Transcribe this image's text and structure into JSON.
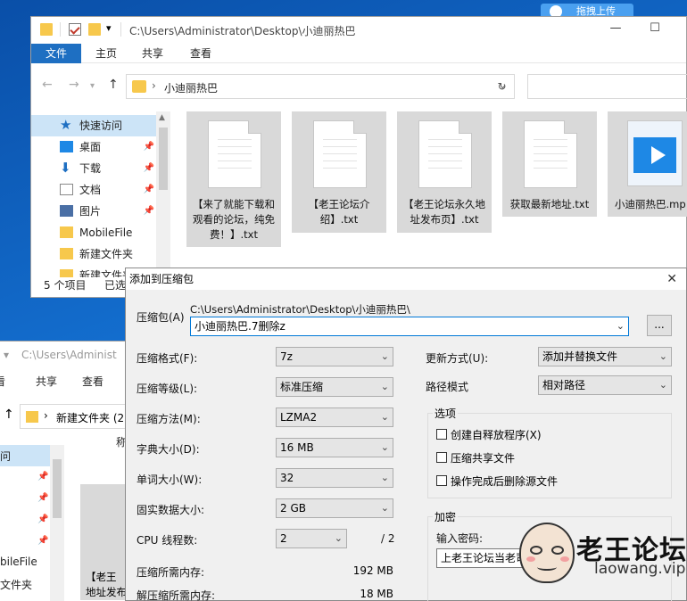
{
  "top_button": {
    "label": "拖拽上传"
  },
  "explorer_main": {
    "title_path": "C:\\Users\\Administrator\\Desktop\\小迪丽热巴",
    "ribbon_tabs": [
      "文件",
      "主页",
      "共享",
      "查看"
    ],
    "address_path": "小迪丽热巴",
    "sidebar": {
      "items": [
        {
          "label": "快速访问",
          "icon": "star-icon"
        },
        {
          "label": "桌面",
          "icon": "desktop-icon"
        },
        {
          "label": "下载",
          "icon": "download-icon"
        },
        {
          "label": "文档",
          "icon": "document-icon"
        },
        {
          "label": "图片",
          "icon": "picture-icon"
        },
        {
          "label": "MobileFile",
          "icon": "folder-icon"
        },
        {
          "label": "新建文件夹",
          "icon": "folder-icon"
        },
        {
          "label": "新建文件夹",
          "icon": "folder-icon"
        }
      ]
    },
    "status": {
      "count": "5 个项目",
      "selected": "已选"
    },
    "files": [
      {
        "name": "【来了就能下载和观看的论坛，纯免费！】.txt",
        "type": "txt"
      },
      {
        "name": "【老王论坛介绍】.txt",
        "type": "txt"
      },
      {
        "name": "【老王论坛永久地址发布页】.txt",
        "type": "txt"
      },
      {
        "name": "获取最新地址.txt",
        "type": "txt"
      },
      {
        "name": "小迪丽热巴.mp",
        "type": "video"
      }
    ]
  },
  "explorer_back": {
    "title_path": "C:\\Users\\Administ",
    "tabs": [
      "看",
      "共享",
      "查看"
    ],
    "address": "新建文件夹 (2",
    "col_header": "称",
    "sidebar_rows": [
      "问",
      "bileFile",
      "文件夹"
    ],
    "file_name_lines": [
      "【老王",
      "地址发布"
    ]
  },
  "dialog": {
    "title": "添加到压缩包",
    "archive_label": "压缩包(A)",
    "archive_path": "C:\\Users\\Administrator\\Desktop\\小迪丽热巴\\",
    "archive_name": "小迪丽热巴.7删除z",
    "browse_label": "...",
    "format_label": "压缩格式(F):",
    "format_value": "7z",
    "level_label": "压缩等级(L):",
    "level_value": "标准压缩",
    "method_label": "压缩方法(M):",
    "method_value": "LZMA2",
    "dict_label": "字典大小(D):",
    "dict_value": "16 MB",
    "word_label": "单词大小(W):",
    "word_value": "32",
    "solid_label": "固实数据大小:",
    "solid_value": "2 GB",
    "threads_label": "CPU 线程数:",
    "threads_value": "2",
    "threads_max": "/ 2",
    "mem_comp_label": "压缩所需内存:",
    "mem_comp_value": "192 MB",
    "mem_decomp_label": "解压缩所需内存:",
    "mem_decomp_value": "18 MB",
    "update_label": "更新方式(U):",
    "update_value": "添加并替换文件",
    "pathmode_label": "路径模式",
    "pathmode_value": "相对路径",
    "options_title": "选项",
    "opt_sfx": "创建自释放程序(X)",
    "opt_shared": "压缩共享文件",
    "opt_delete": "操作完成后删除源文件",
    "encrypt_title": "加密",
    "password_label": "输入密码:",
    "password_value": "上老王论坛当老司机"
  },
  "watermark": {
    "brand": "老王论坛",
    "url": "laowang.vip"
  }
}
